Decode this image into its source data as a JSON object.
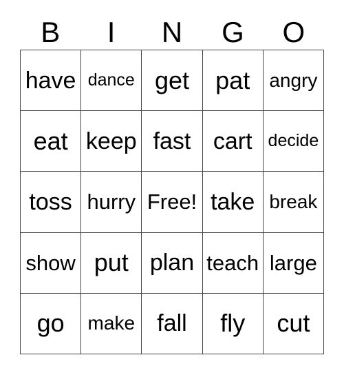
{
  "card": {
    "title": "Bingo Card",
    "columns": 5,
    "rows": 5,
    "border_color": "#444444",
    "background_color": "#ffffff",
    "text_color": "#000000"
  },
  "header": {
    "letters": [
      "B",
      "I",
      "N",
      "G",
      "O"
    ]
  },
  "grid": {
    "rows": [
      {
        "cells": [
          {
            "text": "have",
            "size": "l",
            "free": false
          },
          {
            "text": "dance",
            "size": "xs",
            "free": false
          },
          {
            "text": "get",
            "size": "xl",
            "free": false
          },
          {
            "text": "pat",
            "size": "xl",
            "free": false
          },
          {
            "text": "angry",
            "size": "s",
            "free": false
          }
        ]
      },
      {
        "cells": [
          {
            "text": "eat",
            "size": "xl",
            "free": false
          },
          {
            "text": "keep",
            "size": "l",
            "free": false
          },
          {
            "text": "fast",
            "size": "l",
            "free": false
          },
          {
            "text": "cart",
            "size": "l",
            "free": false
          },
          {
            "text": "decide",
            "size": "xs",
            "free": false
          }
        ]
      },
      {
        "cells": [
          {
            "text": "toss",
            "size": "l",
            "free": false
          },
          {
            "text": "hurry",
            "size": "m",
            "free": false
          },
          {
            "text": "Free!",
            "size": "m",
            "free": true
          },
          {
            "text": "take",
            "size": "l",
            "free": false
          },
          {
            "text": "break",
            "size": "s",
            "free": false
          }
        ]
      },
      {
        "cells": [
          {
            "text": "show",
            "size": "m",
            "free": false
          },
          {
            "text": "put",
            "size": "xl",
            "free": false
          },
          {
            "text": "plan",
            "size": "l",
            "free": false
          },
          {
            "text": "teach",
            "size": "m",
            "free": false
          },
          {
            "text": "large",
            "size": "m",
            "free": false
          }
        ]
      },
      {
        "cells": [
          {
            "text": "go",
            "size": "xl",
            "free": false
          },
          {
            "text": "make",
            "size": "s",
            "free": false
          },
          {
            "text": "fall",
            "size": "l",
            "free": false
          },
          {
            "text": "fly",
            "size": "xl",
            "free": false
          },
          {
            "text": "cut",
            "size": "xl",
            "free": false
          }
        ]
      }
    ]
  }
}
